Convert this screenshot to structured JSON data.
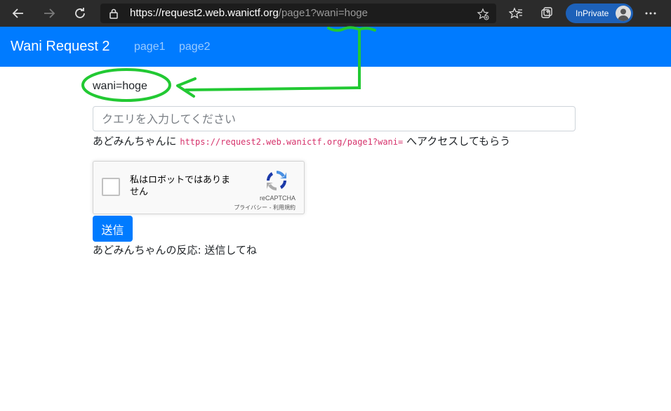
{
  "browser": {
    "url_main": "https://request2.web.wanictf.org",
    "url_rest": "/page1?wani=hoge",
    "inprivate_label": "InPrivate"
  },
  "navbar": {
    "brand": "Wani Request 2",
    "links": [
      "page1",
      "page2"
    ]
  },
  "main": {
    "query_label": "wani=hoge",
    "input_placeholder": "クエリを入力してください",
    "input_value": "",
    "help_prefix": "あどみんちゃんに",
    "help_url": "https://request2.web.wanictf.org/page1?wani=",
    "help_suffix": "へアクセスしてもらう",
    "recaptcha": {
      "label": "私はロボットではありません",
      "brand": "reCAPTCHA",
      "terms": "プライバシー - 利用規約"
    },
    "submit_label": "送信",
    "response_text": "あどみんちゃんの反応: 送信してね"
  },
  "colors": {
    "navbar": "#007bff",
    "annotation": "#22c933"
  },
  "icons": [
    "back-arrow-icon",
    "forward-arrow-icon",
    "refresh-icon",
    "lock-icon",
    "add-favorite-icon",
    "favorites-icon",
    "collections-icon",
    "more-icon",
    "recaptcha-logo-icon"
  ]
}
